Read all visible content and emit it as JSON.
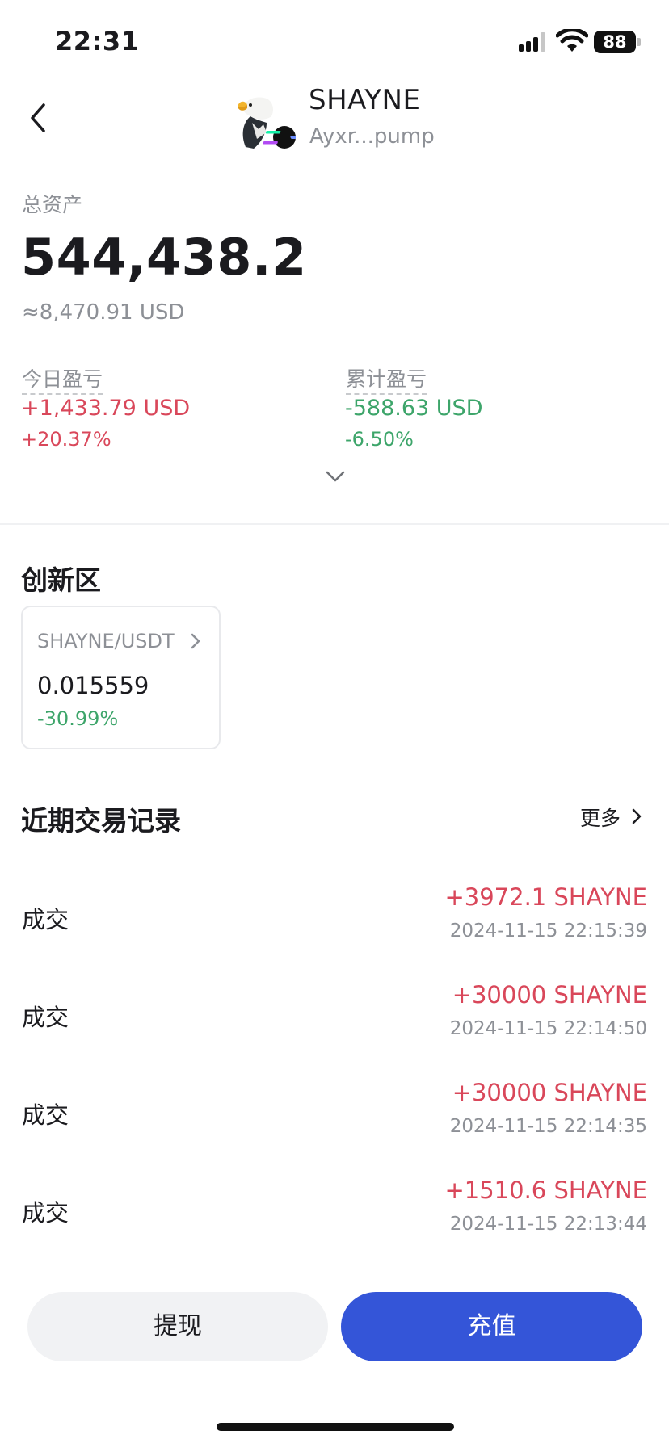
{
  "status_bar": {
    "time": "22:31",
    "battery": "88"
  },
  "header": {
    "token_name": "SHAYNE",
    "token_address": "Ayxr...pump"
  },
  "assets": {
    "total_label": "总资产",
    "total_value": "544,438.2",
    "usd_value": "≈8,470.91 USD",
    "today_pnl": {
      "label": "今日盈亏",
      "value": "+1,433.79 USD",
      "percent": "+20.37%"
    },
    "cumulative_pnl": {
      "label": "累计盈亏",
      "value": "-588.63 USD",
      "percent": "-6.50%"
    }
  },
  "innovation": {
    "title": "创新区",
    "pair": {
      "name": "SHAYNE/USDT",
      "price": "0.015559",
      "change": "-30.99%"
    }
  },
  "recent_trades": {
    "title": "近期交易记录",
    "more_label": "更多",
    "rows": [
      {
        "type": "成交",
        "amount": "+3972.1 SHAYNE",
        "time": "2024-11-15 22:15:39"
      },
      {
        "type": "成交",
        "amount": "+30000 SHAYNE",
        "time": "2024-11-15 22:14:50"
      },
      {
        "type": "成交",
        "amount": "+30000 SHAYNE",
        "time": "2024-11-15 22:14:35"
      },
      {
        "type": "成交",
        "amount": "+1510.6 SHAYNE",
        "time": "2024-11-15 22:13:44"
      }
    ]
  },
  "actions": {
    "withdraw_label": "提现",
    "deposit_label": "充值"
  },
  "colors": {
    "up": "#d9475a",
    "down": "#3da56a",
    "primary": "#3455d8"
  },
  "icons": [
    "back-arrow-icon",
    "eagle-logo-icon",
    "solana-badge-icon",
    "chevron-down-icon",
    "chevron-right-icon",
    "signal-icon",
    "wifi-icon",
    "battery-icon"
  ]
}
